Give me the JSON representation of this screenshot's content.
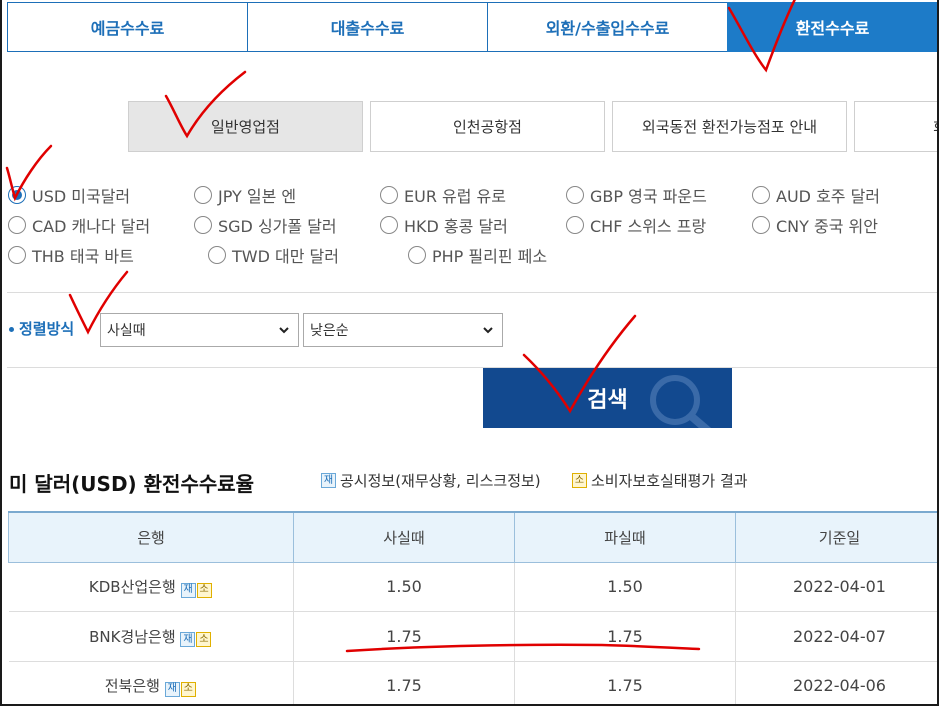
{
  "tabs": [
    {
      "label": "예금수수료",
      "active": false
    },
    {
      "label": "대출수수료",
      "active": false
    },
    {
      "label": "외환/수출입수수료",
      "active": false
    },
    {
      "label": "환전수수료",
      "active": true
    }
  ],
  "branches": [
    {
      "label": "일반영업점",
      "active": true
    },
    {
      "label": "인천공항점",
      "active": false
    },
    {
      "label": "외국동전 환전가능점포 안내",
      "active": false
    },
    {
      "label": "화",
      "active": false
    }
  ],
  "currencies": [
    [
      {
        "label": "USD 미국달러",
        "checked": true
      },
      {
        "label": "JPY 일본 엔"
      },
      {
        "label": "EUR 유럽 유로"
      },
      {
        "label": "GBP 영국 파운드"
      },
      {
        "label": "AUD 호주 달러"
      }
    ],
    [
      {
        "label": "CAD 캐나다 달러"
      },
      {
        "label": "SGD 싱가폴 달러"
      },
      {
        "label": "HKD 홍콩 달러"
      },
      {
        "label": "CHF 스위스 프랑"
      },
      {
        "label": "CNY 중국 위안"
      }
    ],
    [
      {
        "label": "THB 태국 바트"
      },
      {
        "label": "TWD 대만 달러"
      },
      {
        "label": "PHP 필리핀 페소"
      }
    ]
  ],
  "sort": {
    "label": "정렬방식",
    "field_value": "사실때",
    "order_value": "낮은순"
  },
  "search_label": "검색",
  "result": {
    "title": "미 달러(USD) 환전수수료율",
    "legend_jae_badge": "재",
    "legend_jae_text": "공시정보(재무상황, 리스크정보)",
    "legend_so_badge": "소",
    "legend_so_text": "소비자보호실태평가 결과"
  },
  "table": {
    "headers": [
      "은행",
      "사실때",
      "파실때",
      "기준일"
    ],
    "rows": [
      {
        "bank": "KDB산업은행",
        "buy": "1.50",
        "sell": "1.50",
        "date": "2022-04-01"
      },
      {
        "bank": "BNK경남은행",
        "buy": "1.75",
        "sell": "1.75",
        "date": "2022-04-07"
      },
      {
        "bank": "전북은행",
        "buy": "1.75",
        "sell": "1.75",
        "date": "2022-04-06"
      }
    ],
    "badge_jae": "재",
    "badge_so": "소"
  },
  "colors": {
    "accent": "#1d7bc8",
    "search_button": "#12498f",
    "annotation": "#e00000"
  },
  "icons": {
    "search_background": "magnifier-icon",
    "select_arrow": "chevron-down-icon"
  }
}
